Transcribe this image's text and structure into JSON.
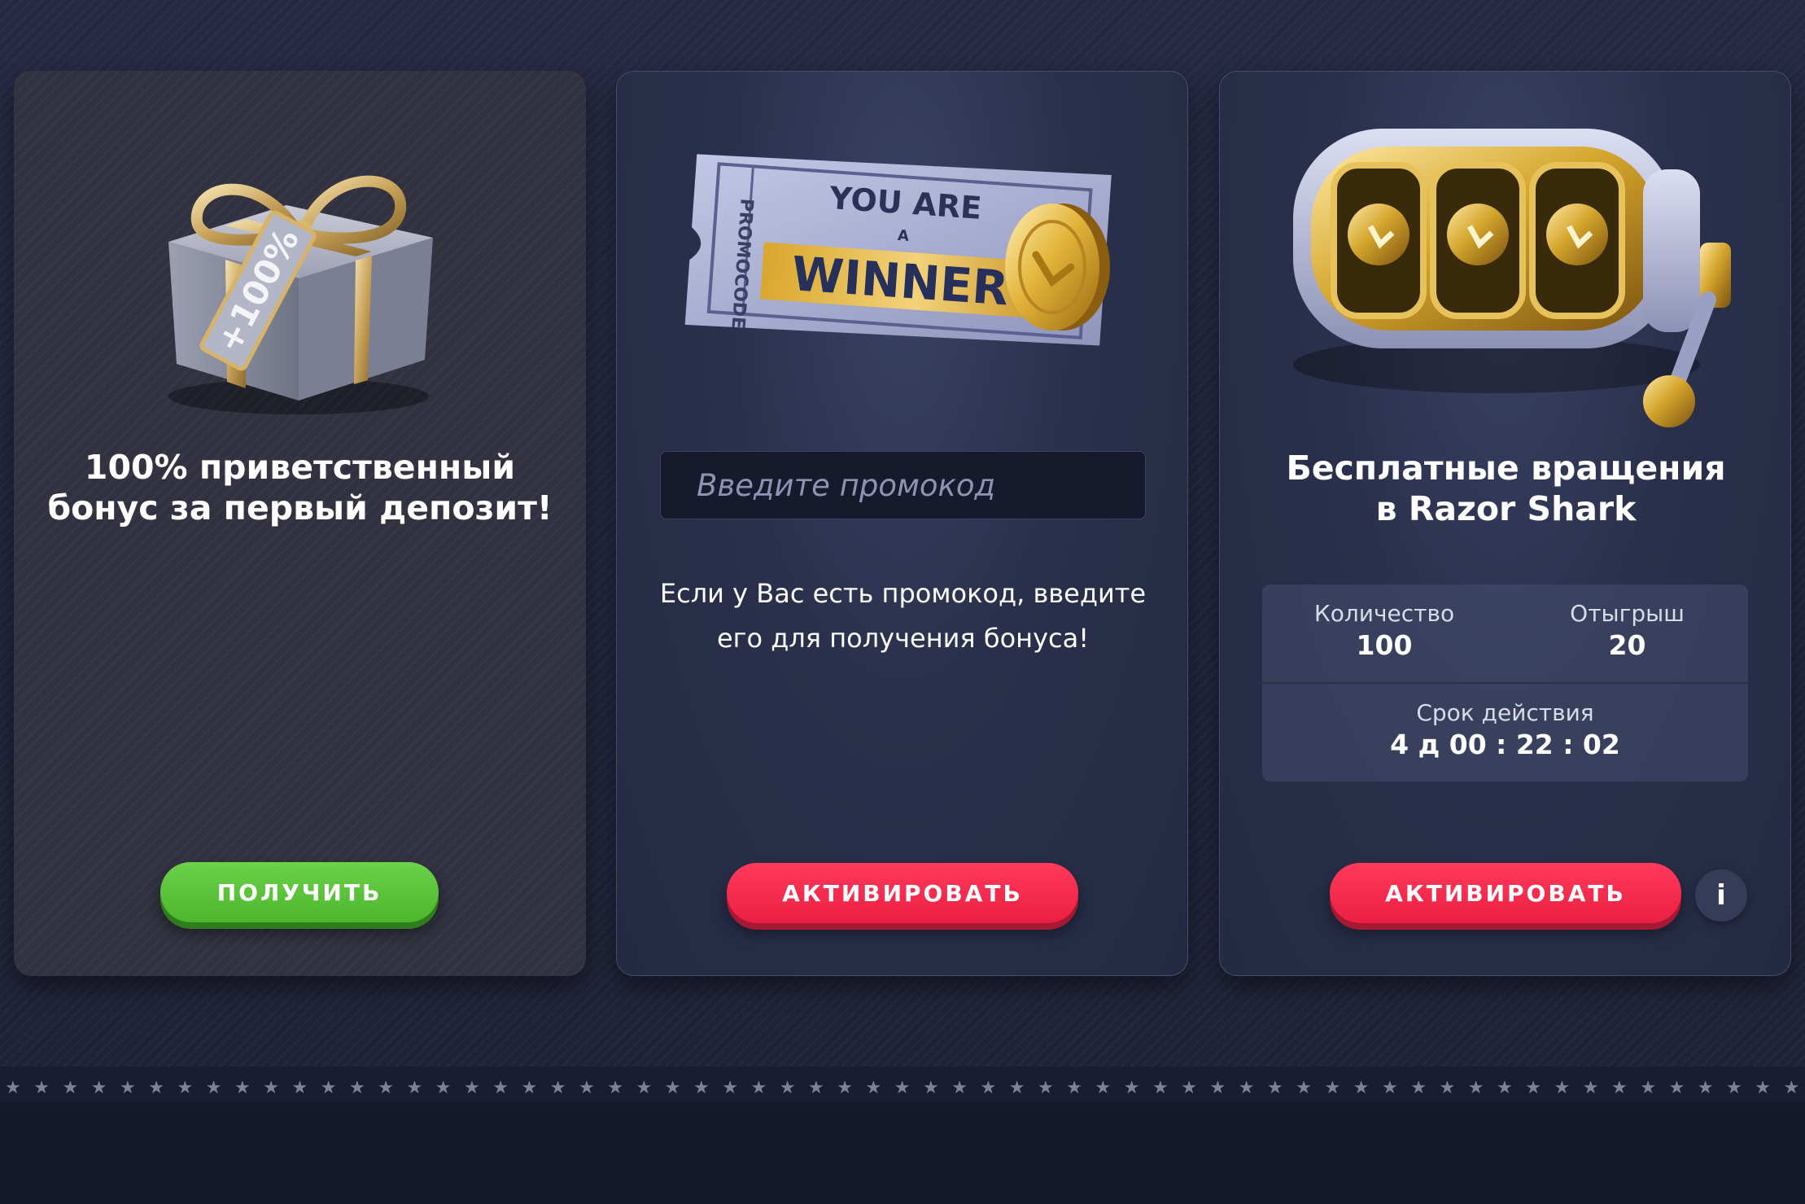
{
  "cards": [
    {
      "title_lines": [
        "100% приветственный",
        "бонус за первый депозит!"
      ],
      "button_label": "ПОЛУЧИТЬ",
      "image": "gift-box-icon",
      "tag_text": "+100%"
    },
    {
      "ticket_text": {
        "top": "YOU ARE",
        "mid": "A",
        "main": "WINNER",
        "side": "PROMOCODE"
      },
      "input_placeholder": "Введите промокод",
      "description": "Если у Вас есть промокод, введите его для получения бонуса!",
      "button_label": "АКТИВИРОВАТЬ",
      "image": "promo-ticket-icon"
    },
    {
      "title_lines": [
        "Бесплатные вращения",
        "в Razor Shark"
      ],
      "stats": {
        "quantity_label": "Количество",
        "quantity_value": "100",
        "wager_label": "Отыгрыш",
        "wager_value": "20",
        "validity_label": "Срок действия",
        "validity_value": "4 д 00 : 22 : 02"
      },
      "button_label": "АКТИВИРОВАТЬ",
      "info_label": "i",
      "image": "slot-machine-icon"
    }
  ],
  "colors": {
    "green_button": "#4cb62d",
    "red_button": "#ec1f43",
    "card_dark": "#31313f",
    "card_navy": "#2a304b",
    "gold": "#d4a52c"
  }
}
